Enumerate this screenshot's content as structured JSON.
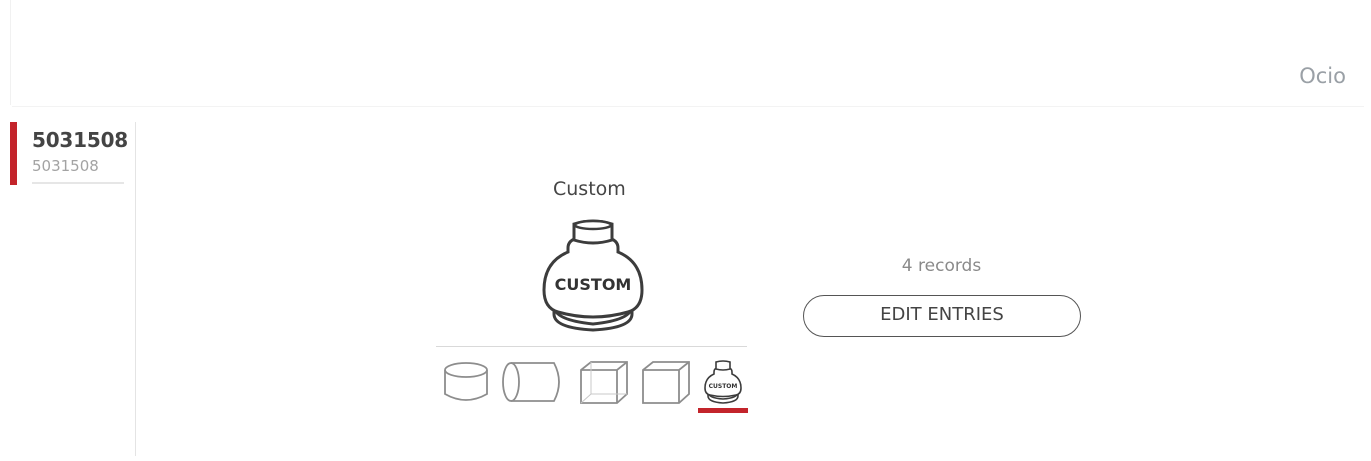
{
  "header": {
    "user_name": "Ocio"
  },
  "sidebar": {
    "items": [
      {
        "title": "5031508",
        "subtitle": "5031508",
        "active": true
      }
    ]
  },
  "shape_selector": {
    "selected_label": "Custom",
    "big_shape_text": "CUSTOM",
    "small_shape_text": "CUSTOM",
    "options": [
      {
        "name": "cylinder-vertical-icon"
      },
      {
        "name": "cylinder-horizontal-icon"
      },
      {
        "name": "box-icon"
      },
      {
        "name": "cube-icon"
      },
      {
        "name": "custom-bottle-icon",
        "selected": true
      }
    ]
  },
  "records": {
    "count_text": "4 records",
    "edit_button_label": "EDIT ENTRIES"
  },
  "colors": {
    "accent": "#c3242b",
    "text_muted": "#a3a3a3",
    "border": "#e4e4e4"
  }
}
